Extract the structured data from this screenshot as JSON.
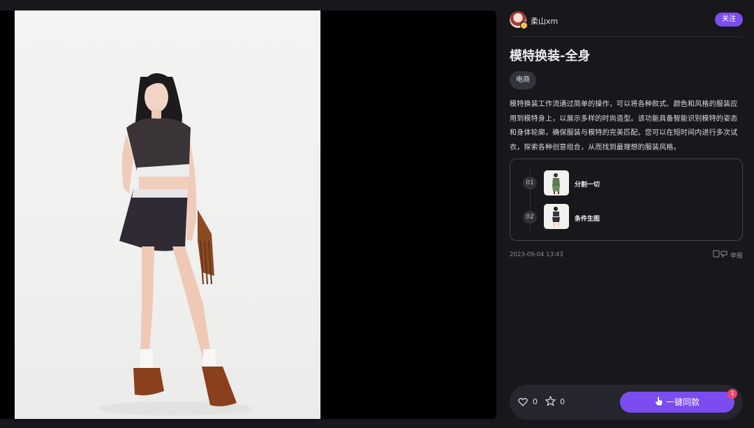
{
  "author": {
    "name": "柔山xm",
    "follow_label": "关注"
  },
  "post": {
    "title": "模特换装-全身",
    "tag": "电商",
    "description": "模特换装工作流通过简单的操作，可以将各种款式、颜色和风格的服装应用到模特身上，以展示多样的时尚造型。该功能具备智能识别模特的姿态和身体轮廓，确保服装与模特的完美匹配。您可以在短时间内进行多次试衣，探索各种创意组合，从而找到最理想的服装风格。",
    "steps": [
      {
        "num": "01",
        "label": "分割一切"
      },
      {
        "num": "02",
        "label": "条件生图"
      }
    ],
    "date": "2023-09-04 13:43",
    "report_label": "举报"
  },
  "bottom_bar": {
    "likes": "0",
    "favorites": "0",
    "cta_label": "一键同款",
    "cta_badge": "1"
  },
  "colors": {
    "accent": "#7b4df0",
    "badge": "#f0436a",
    "background": "#18181c"
  }
}
